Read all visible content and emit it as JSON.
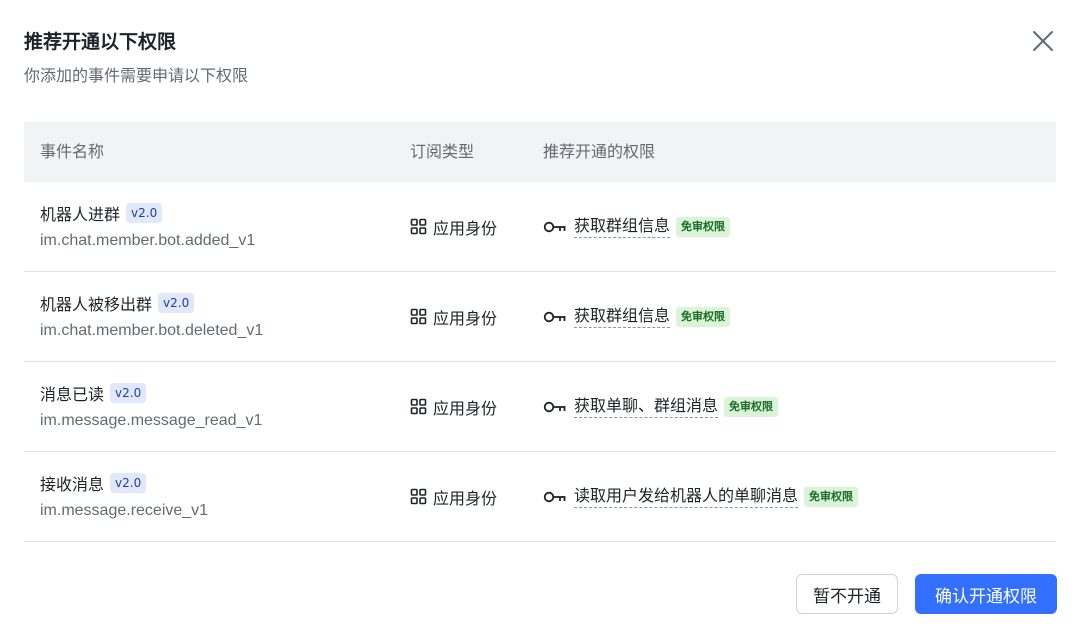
{
  "dialog": {
    "title": "推荐开通以下权限",
    "subtitle": "你添加的事件需要申请以下权限",
    "close_icon": "close-icon"
  },
  "table": {
    "headers": [
      "事件名称",
      "订阅类型",
      "推荐开通的权限"
    ],
    "rows": [
      {
        "event_name": "机器人进群",
        "version": "v2.0",
        "event_key": "im.chat.member.bot.added_v1",
        "subscribe_type": "应用身份",
        "permission": "获取群组信息",
        "badge": "免审权限"
      },
      {
        "event_name": "机器人被移出群",
        "version": "v2.0",
        "event_key": "im.chat.member.bot.deleted_v1",
        "subscribe_type": "应用身份",
        "permission": "获取群组信息",
        "badge": "免审权限"
      },
      {
        "event_name": "消息已读",
        "version": "v2.0",
        "event_key": "im.message.message_read_v1",
        "subscribe_type": "应用身份",
        "permission": "获取单聊、群组消息",
        "badge": "免审权限"
      },
      {
        "event_name": "接收消息",
        "version": "v2.0",
        "event_key": "im.message.receive_v1",
        "subscribe_type": "应用身份",
        "permission": "读取用户发给机器人的单聊消息",
        "badge": "免审权限"
      }
    ]
  },
  "footer": {
    "cancel_label": "暂不开通",
    "confirm_label": "确认开通权限"
  },
  "colors": {
    "primary": "#3370ff",
    "version_bg": "#e1e8fc",
    "badge_bg": "#d9f5d6",
    "header_bg": "#f2f3f5"
  }
}
